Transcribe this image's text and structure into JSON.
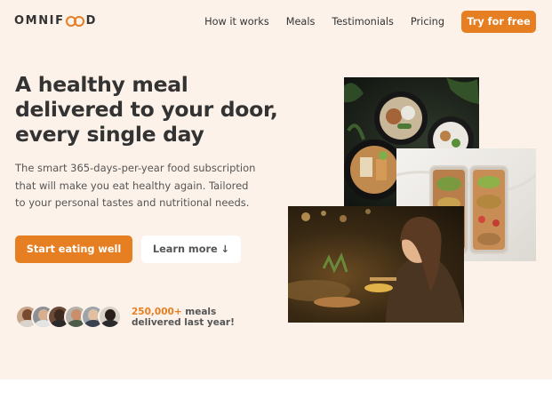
{
  "header": {
    "logo_text_start": "OMNIF",
    "logo_text_end": "D",
    "nav": [
      {
        "label": "How it works"
      },
      {
        "label": "Meals"
      },
      {
        "label": "Testimonials"
      },
      {
        "label": "Pricing"
      }
    ],
    "cta_label": "Try for free"
  },
  "hero": {
    "title": "A healthy meal delivered to your door, every single day",
    "description": "The smart 365-days-per-year food subscription that will make you eat healthy again. Tailored to your personal tastes and nutritional needs.",
    "primary_button": "Start eating well",
    "secondary_button": "Learn more ↓",
    "delivered_count": "250,000+",
    "delivered_text": " meals delivered last year!"
  },
  "colors": {
    "accent": "#e67e22",
    "hero_background": "#fdf2e9",
    "text": "#333333"
  },
  "images": [
    {
      "name": "meal-bowls-photo"
    },
    {
      "name": "meal-boxes-photo"
    },
    {
      "name": "woman-eating-photo"
    }
  ]
}
